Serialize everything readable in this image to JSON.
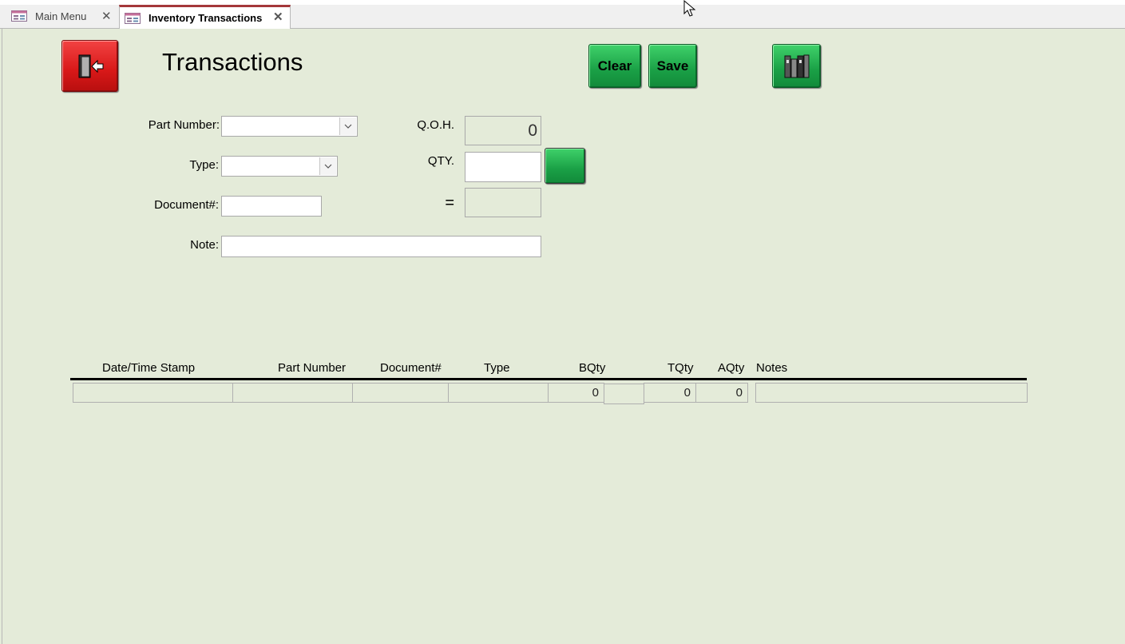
{
  "tabs": [
    {
      "label": "Main Menu",
      "active": false
    },
    {
      "label": "Inventory Transactions",
      "active": true
    }
  ],
  "form": {
    "title": "Transactions",
    "exit_icon": "exit-door-icon",
    "clear_label": "Clear",
    "save_label": "Save",
    "library_icon": "books-icon",
    "part_number_label": "Part Number:",
    "part_number_value": "",
    "type_label": "Type:",
    "type_value": "",
    "document_label": "Document#:",
    "document_value": "",
    "note_label": "Note:",
    "note_value": "",
    "qoh_label": "Q.O.H.",
    "qoh_value": "0",
    "qty_label": "QTY.",
    "qty_value": "",
    "equals_label": "=",
    "result_value": ""
  },
  "table": {
    "columns": [
      "Date/Time Stamp",
      "Part Number",
      "Document#",
      "Type",
      "BQty",
      "TQty",
      "AQty",
      "Notes"
    ],
    "rows": [
      {
        "datetime": "",
        "part_number": "",
        "document": "",
        "type": "",
        "bqty": "0",
        "extra": "",
        "tqty": "0",
        "aqty": "0",
        "notes": ""
      }
    ]
  },
  "colors": {
    "background": "#e4ebd9",
    "green_button": "#1aa046",
    "red_button": "#d81818",
    "active_tab_accent": "#a4373a"
  }
}
